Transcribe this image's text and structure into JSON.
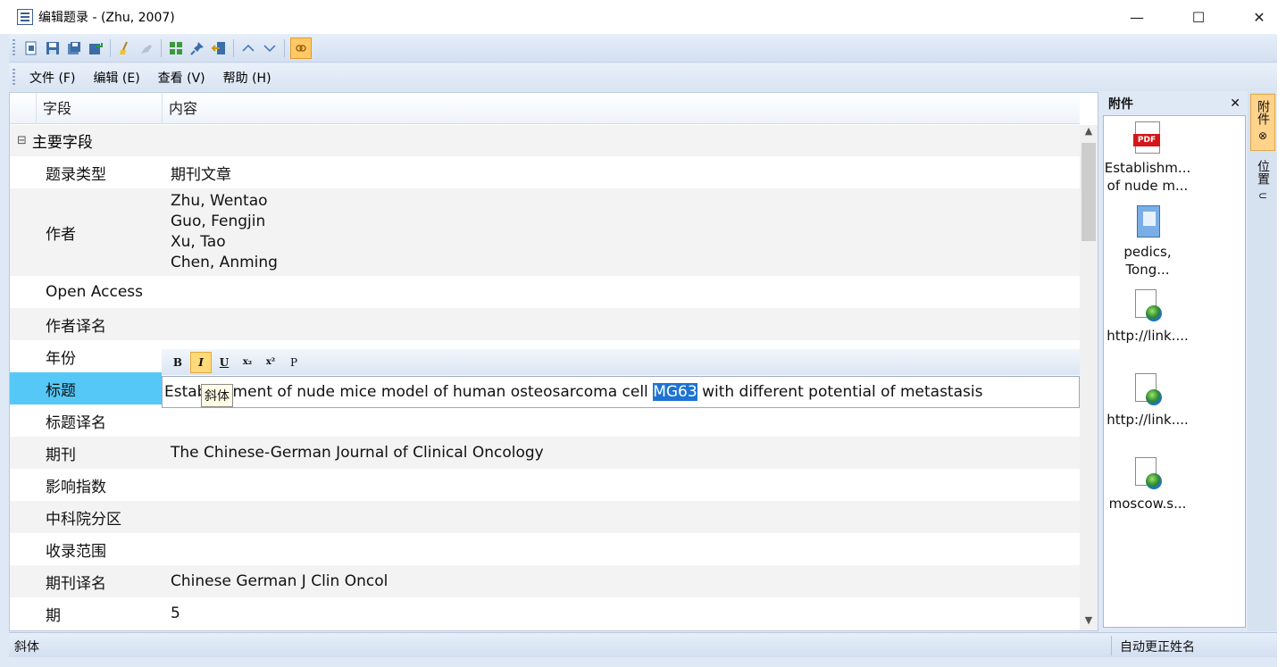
{
  "window": {
    "title": "编辑题录 - (Zhu, 2007)",
    "minimize_glyph": "—",
    "maximize_glyph": "☐",
    "close_glyph": "✕"
  },
  "toolbar": {
    "icons": [
      "new-icon",
      "save-icon",
      "save-all-icon",
      "export-icon",
      "clean-icon",
      "brush-icon",
      "grid-icon",
      "pin-icon",
      "exit-icon",
      "up-icon",
      "down-icon",
      "link-icon"
    ]
  },
  "menu": {
    "file": "文件 (F)",
    "edit": "编辑 (E)",
    "view": "查看 (V)",
    "help": "帮助 (H)"
  },
  "grid": {
    "col_field": "字段",
    "col_content": "内容",
    "group": "主要字段",
    "group_toggle": "⊟",
    "rows": [
      {
        "field": "题录类型",
        "value": "期刊文章"
      },
      {
        "field": "作者",
        "authors": [
          "Zhu, Wentao",
          "Guo, Fengjin",
          "Xu, Tao",
          "Chen, Anming"
        ]
      },
      {
        "field": "Open Access",
        "value": ""
      },
      {
        "field": "作者译名",
        "value": ""
      },
      {
        "field": "年份",
        "value": ""
      },
      {
        "field": "标题",
        "value": ""
      },
      {
        "field": "标题译名",
        "value": ""
      },
      {
        "field": "期刊",
        "value": "The Chinese-German Journal of Clinical Oncology"
      },
      {
        "field": "影响指数",
        "value": ""
      },
      {
        "field": "中科院分区",
        "value": ""
      },
      {
        "field": "收录范围",
        "value": ""
      },
      {
        "field": "期刊译名",
        "value": "Chinese German J Clin Oncol"
      },
      {
        "field": "期",
        "value": "5"
      }
    ]
  },
  "format_bar": {
    "bold": "B",
    "italic": "I",
    "underline": "U",
    "subscript": "x₂",
    "superscript": "x²",
    "plain": "P"
  },
  "editor": {
    "before": "Establishment of nude mice model of human osteosarcoma cell ",
    "highlight": "MG63",
    "after": " with different potential of metastasis"
  },
  "tooltip": "斜体",
  "attachments": {
    "title": "附件",
    "close": "✕",
    "items": [
      {
        "icon": "pdf-icon",
        "line1": "Establishm...",
        "line2": "of nude m..."
      },
      {
        "icon": "notebook-icon",
        "line1": "pedics,",
        "line2": "Tong..."
      },
      {
        "icon": "web-link-icon",
        "line1": "http://link....",
        "line2": ""
      },
      {
        "icon": "web-link-icon",
        "line1": "http://link....",
        "line2": ""
      },
      {
        "icon": "web-link-icon",
        "line1": "moscow.s...",
        "line2": ""
      }
    ]
  },
  "side_tabs": {
    "attachments": "附件",
    "location": "位置"
  },
  "status": {
    "left": "斜体",
    "right": "自动更正姓名"
  },
  "colors": {
    "selected_row": "#56c8f7",
    "highlight": "#1c73d4",
    "chrome": "#dfe8f5"
  }
}
